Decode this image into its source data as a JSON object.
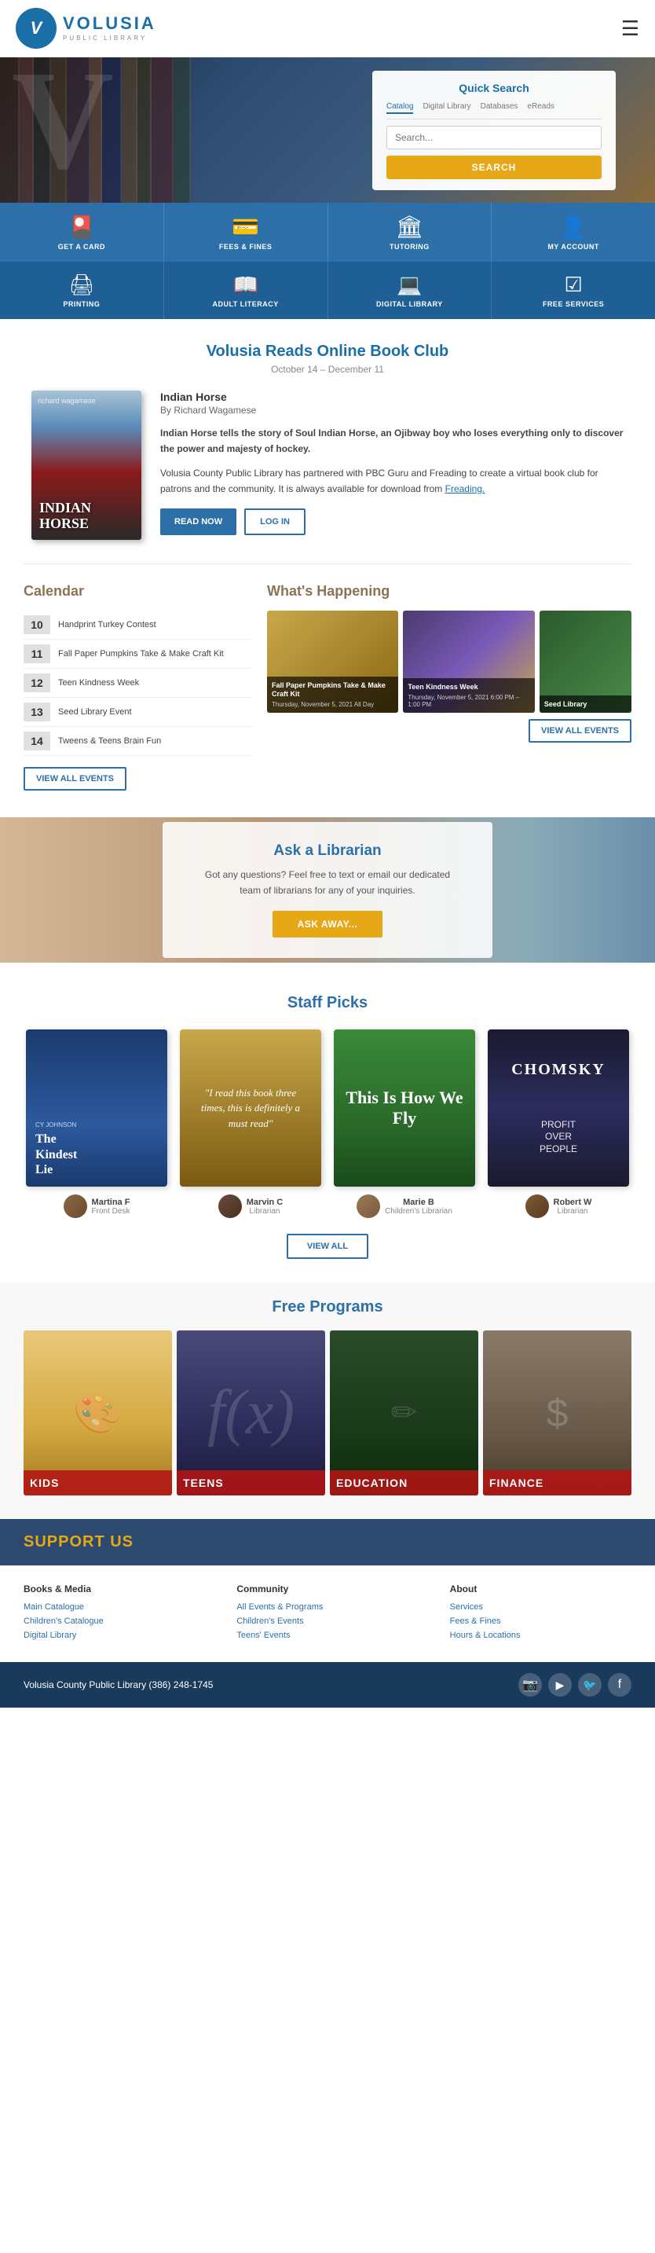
{
  "header": {
    "logo_name": "VOLUSIA",
    "logo_sub1": "PUBLIC",
    "logo_sub2": "LIBRARY"
  },
  "quick_search": {
    "title": "Quick Search",
    "placeholder": "Search...",
    "tabs": [
      "Catalog",
      "Digital Library",
      "Databases",
      "eReads"
    ],
    "button_label": "SEARCH"
  },
  "nav_row1": [
    {
      "icon": "🎴",
      "label": "GET A CARD"
    },
    {
      "icon": "💰",
      "label": "FEES & FINES"
    },
    {
      "icon": "🏛",
      "label": "TUTORING"
    },
    {
      "icon": "👤",
      "label": "MY ACCOUNT"
    }
  ],
  "nav_row2": [
    {
      "icon": "🖨",
      "label": "PRINTING"
    },
    {
      "icon": "📚",
      "label": "ADULT LITERACY"
    },
    {
      "icon": "💻",
      "label": "DIGITAL LIBRARY"
    },
    {
      "icon": "☑",
      "label": "FREE SERVICES"
    }
  ],
  "book_club": {
    "title": "Volusia Reads Online Book Club",
    "date": "October 14 – December 11",
    "book_title": "Indian Horse",
    "book_author": "By Richard Wagamese",
    "description1": "Indian Horse tells the story of Soul Indian Horse, an Ojibway boy who loses everything only to discover the power and majesty of hockey.",
    "description2": "Volusia County Public Library has partnered with PBC Guru and Freading to create a virtual book club for patrons and the community. It is always available for download from Freading.",
    "freading_link": "Freading.",
    "read_now": "READ NOW",
    "log_in": "LOG IN"
  },
  "calendar": {
    "title": "Calendar",
    "items": [
      {
        "date": "10",
        "event": "Handprint Turkey Contest"
      },
      {
        "date": "11",
        "event": "Fall Paper Pumpkins Take & Make Craft Kit"
      },
      {
        "date": "12",
        "event": "Teen Kindness Week"
      },
      {
        "date": "13",
        "event": "Seed Library Event"
      },
      {
        "date": "14",
        "event": "Tweens & Teens Brain Fun"
      }
    ],
    "view_all": "VIEW ALL EVENTS"
  },
  "whats_happening": {
    "title": "What's Happening",
    "events": [
      {
        "title": "Fall Paper Pumpkins Take & Make Craft Kit",
        "date": "Thursday, November 5, 2021 All Day"
      },
      {
        "title": "Teen Kindness Week",
        "date": "Thursday, November 5, 2021 6:00 PM – 1:00 PM"
      },
      {
        "title": "Seed Library"
      }
    ],
    "view_all": "VIEW ALL EVENTS"
  },
  "ask_librarian": {
    "title": "Ask a Librarian",
    "text": "Got any questions? Feel free to text or email our dedicated team of librarians for any of your inquiries.",
    "button": "ASK AWAY..."
  },
  "staff_picks": {
    "title": "Staff Picks",
    "picks": [
      {
        "book_title": "The Kindest Lie",
        "reviewer": "Martina F",
        "role": "Front Desk"
      },
      {
        "book_title": "\"I read this book three times, this is definitely a must read\"",
        "reviewer": "Marvin C",
        "role": "Librarian"
      },
      {
        "book_title": "This Is How We Fly",
        "reviewer": "Marie B",
        "role": "Children's Librarian"
      },
      {
        "book_title": "CHOMSKY Profit Over People",
        "reviewer": "Robert W",
        "role": "Librarian"
      }
    ],
    "view_all": "VIEW ALL"
  },
  "free_programs": {
    "title": "Free Programs",
    "categories": [
      {
        "label": "KIDS"
      },
      {
        "label": "TEENS"
      },
      {
        "label": "EDUCATION"
      },
      {
        "label": "FINANCE"
      }
    ]
  },
  "support_us": {
    "title": "SUPPORT US"
  },
  "footer": {
    "columns": [
      {
        "title": "Books & Media",
        "links": [
          "Main Catalogue",
          "Children's Catalogue",
          "Digital Library"
        ]
      },
      {
        "title": "Community",
        "links": [
          "All Events & Programs",
          "Children's Events",
          "Teens' Events"
        ]
      },
      {
        "title": "About",
        "links": [
          "Services",
          "Fees & Fines",
          "Hours & Locations"
        ]
      }
    ],
    "contact": "Volusia County Public Library (386) 248-1745",
    "social": [
      "instagram",
      "youtube",
      "twitter",
      "facebook"
    ]
  }
}
